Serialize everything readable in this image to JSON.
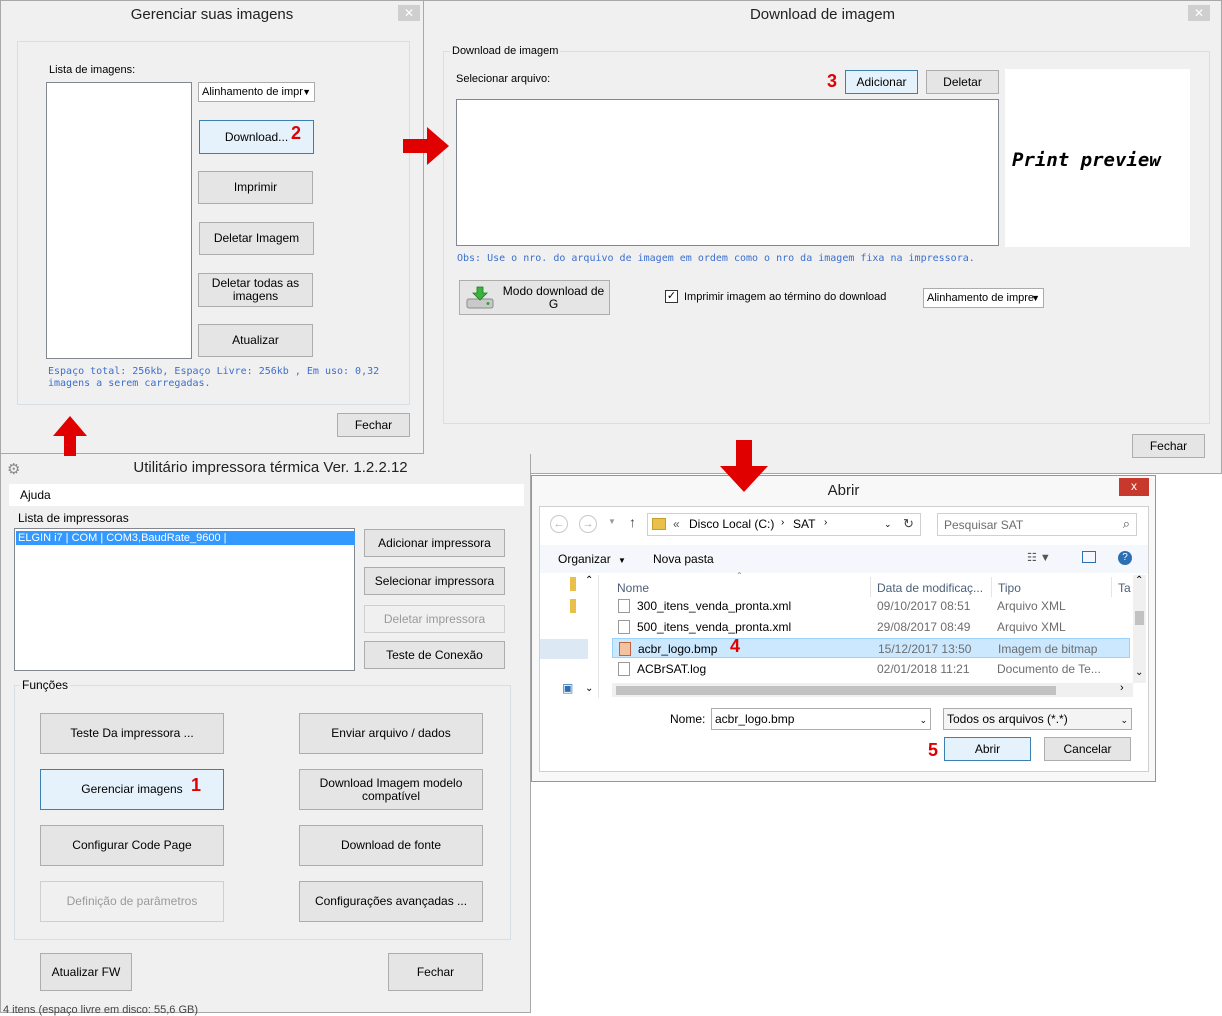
{
  "manage": {
    "title": "Gerenciar suas imagens",
    "list_label": "Lista de imagens:",
    "alignment_select": "Alinhamento de impr",
    "download_button": "Download...",
    "print_button": "Imprimir",
    "delete_button": "Deletar Imagem",
    "delete_all_button": "Deletar todas as imagens",
    "refresh_button": "Atualizar",
    "space_info": "Espaço total: 256kb, Espaço Livre: 256kb , Em uso: 0,32 imagens a serem carregadas.",
    "close_button": "Fechar"
  },
  "download": {
    "title": "Download de imagem",
    "group_label": "Download de imagem",
    "select_file_label": "Selecionar arquivo:",
    "add_button": "Adicionar",
    "delete_button": "Deletar",
    "preview_text": "Print preview",
    "note": "Obs: Use o nro. do arquivo de imagem em ordem como o nro da imagem fixa na impressora.",
    "mode_button": "Modo download de G",
    "print_checkbox_label": "Imprimir imagem ao término do download",
    "print_checked": true,
    "alignment_select": "Alinhamento de impre",
    "close_button": "Fechar"
  },
  "utility": {
    "title": "Utilitário impressora térmica Ver. 1.2.2.12",
    "menu_help": "Ajuda",
    "printers_label": "Lista de impressoras",
    "printer_item": "ELGIN i7 | COM | COM3,BaudRate_9600 |",
    "add_printer": "Adicionar impressora",
    "select_printer": "Selecionar impressora",
    "delete_printer": "Deletar impressora",
    "test_connection": "Teste de Conexão",
    "functions_label": "Funções",
    "test_printer": "Teste Da impressora ...",
    "send_file": "Enviar arquivo / dados",
    "manage_images": "Gerenciar imagens",
    "download_image_model": "Download Imagem modelo compatível",
    "config_code_page": "Configurar Code Page",
    "download_font": "Download de fonte",
    "param_definition": "Definição de parâmetros",
    "advanced_config": "Configurações avançadas ...",
    "update_fw": "Atualizar FW",
    "close_button": "Fechar",
    "status_bar": "4 itens (espaço livre em disco: 55,6 GB)"
  },
  "open_dialog": {
    "title": "Abrir",
    "close": "x",
    "breadcrumb_prefix": "«",
    "breadcrumb": [
      "Disco Local (C:)",
      "SAT"
    ],
    "search_placeholder": "Pesquisar SAT",
    "organize": "Organizar",
    "new_folder": "Nova pasta",
    "columns": [
      "Nome",
      "Data de modificaç...",
      "Tipo",
      "Ta"
    ],
    "files": [
      {
        "name": "300_itens_venda_pronta.xml",
        "date": "09/10/2017 08:51",
        "type": "Arquivo XML"
      },
      {
        "name": "500_itens_venda_pronta.xml",
        "date": "29/08/2017 08:49",
        "type": "Arquivo XML"
      },
      {
        "name": "acbr_logo.bmp",
        "date": "15/12/2017 13:50",
        "type": "Imagem de bitmap"
      },
      {
        "name": "ACBrSAT.log",
        "date": "02/01/2018 11:21",
        "type": "Documento de Te..."
      }
    ],
    "name_label": "Nome:",
    "name_value": "acbr_logo.bmp",
    "filter_value": "Todos os arquivos (*.*)",
    "open_button": "Abrir",
    "cancel_button": "Cancelar"
  },
  "steps": [
    "1",
    "2",
    "3",
    "4",
    "5"
  ],
  "accent_red": "#e00000"
}
